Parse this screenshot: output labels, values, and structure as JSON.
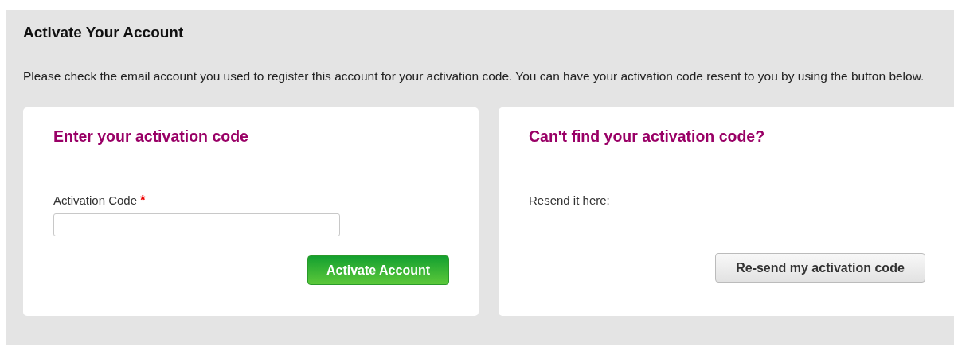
{
  "page": {
    "title": "Activate Your Account",
    "intro": "Please check the email account you used to register this account for your activation code. You can have your activation code resent to you by using the button below."
  },
  "cards": [
    {
      "kind": "form",
      "title": "Enter your activation code",
      "field": {
        "label": "Activation Code",
        "required_mark": "*"
      },
      "button": {
        "label": "Activate Account"
      }
    },
    {
      "kind": "resend",
      "title": "Can't find your activation code?",
      "text": "Resend it here:",
      "button": {
        "label": "Re-send my activation code"
      }
    }
  ]
}
